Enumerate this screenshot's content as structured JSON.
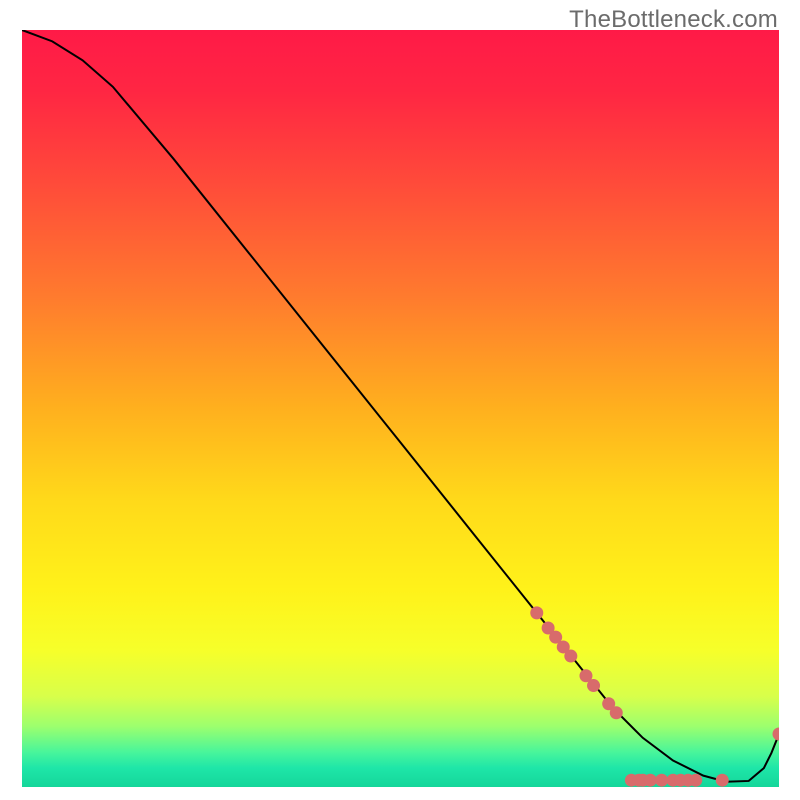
{
  "watermark": "TheBottleneck.com",
  "colors": {
    "gradient_stops": [
      {
        "offset": 0.0,
        "color": "#ff1a47"
      },
      {
        "offset": 0.08,
        "color": "#ff2643"
      },
      {
        "offset": 0.2,
        "color": "#ff4a3a"
      },
      {
        "offset": 0.35,
        "color": "#ff7a2e"
      },
      {
        "offset": 0.5,
        "color": "#ffb01e"
      },
      {
        "offset": 0.62,
        "color": "#ffd91a"
      },
      {
        "offset": 0.74,
        "color": "#fff21a"
      },
      {
        "offset": 0.82,
        "color": "#f6ff2a"
      },
      {
        "offset": 0.88,
        "color": "#d8ff4a"
      },
      {
        "offset": 0.92,
        "color": "#9cff6e"
      },
      {
        "offset": 0.955,
        "color": "#46f59c"
      },
      {
        "offset": 0.975,
        "color": "#1ee6a8"
      },
      {
        "offset": 1.0,
        "color": "#15d69a"
      }
    ],
    "line": "#000000",
    "dot": "#d86b6b",
    "dot_stroke": "#c45a5a"
  },
  "chart_data": {
    "type": "line",
    "title": "",
    "xlabel": "",
    "ylabel": "",
    "xlim": [
      0,
      100
    ],
    "ylim": [
      0,
      100
    ],
    "series": [
      {
        "name": "curve",
        "x": [
          0,
          4,
          8,
          12,
          20,
          30,
          40,
          50,
          60,
          68,
          74,
          78,
          82,
          86,
          90,
          93,
          96,
          98,
          99,
          100
        ],
        "y": [
          100,
          98.5,
          96,
          92.5,
          83,
          70.5,
          58,
          45.5,
          33,
          23,
          15.5,
          10.5,
          6.5,
          3.5,
          1.5,
          0.7,
          0.8,
          2.5,
          4.5,
          7
        ]
      }
    ],
    "dots": [
      {
        "x": 68.0,
        "y": 23.0
      },
      {
        "x": 69.5,
        "y": 21.0
      },
      {
        "x": 70.5,
        "y": 19.8
      },
      {
        "x": 71.5,
        "y": 18.5
      },
      {
        "x": 72.5,
        "y": 17.3
      },
      {
        "x": 74.5,
        "y": 14.7
      },
      {
        "x": 75.5,
        "y": 13.4
      },
      {
        "x": 77.5,
        "y": 11.0
      },
      {
        "x": 78.5,
        "y": 9.8
      },
      {
        "x": 80.5,
        "y": 0.9
      },
      {
        "x": 81.5,
        "y": 0.9
      },
      {
        "x": 82.0,
        "y": 0.9
      },
      {
        "x": 83.0,
        "y": 0.9
      },
      {
        "x": 84.5,
        "y": 0.9
      },
      {
        "x": 86.0,
        "y": 0.9
      },
      {
        "x": 87.0,
        "y": 0.9
      },
      {
        "x": 88.0,
        "y": 0.9
      },
      {
        "x": 89.0,
        "y": 0.9
      },
      {
        "x": 92.5,
        "y": 0.9
      },
      {
        "x": 100.0,
        "y": 7.0
      }
    ]
  }
}
